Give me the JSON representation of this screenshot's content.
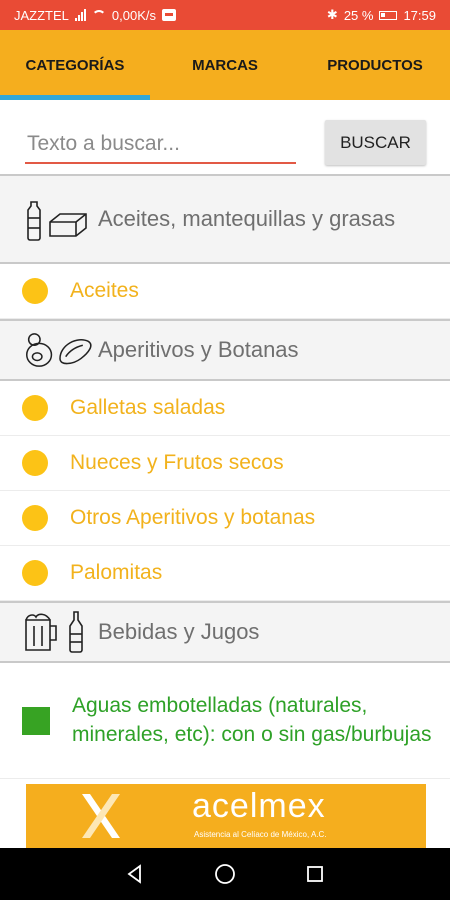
{
  "status_bar": {
    "carrier": "JAZZTEL",
    "speed": "0,00K/s",
    "battery": "25 %",
    "time": "17:59"
  },
  "tabs": [
    {
      "label": "CATEGORÍAS",
      "active": true
    },
    {
      "label": "MARCAS",
      "active": false
    },
    {
      "label": "PRODUCTOS",
      "active": false
    }
  ],
  "search": {
    "placeholder": "Texto a buscar...",
    "button_label": "BUSCAR"
  },
  "list": [
    {
      "kind": "category",
      "label": "Aceites, mantequillas y grasas",
      "icon": "oil-butter-icon"
    },
    {
      "kind": "item",
      "label": "Aceites",
      "color": "#fcc316"
    },
    {
      "kind": "category",
      "label": "Aperitivos y Botanas",
      "icon": "snacks-icon"
    },
    {
      "kind": "item",
      "label": "Galletas saladas",
      "color": "#fcc316"
    },
    {
      "kind": "item",
      "label": "Nueces y Frutos secos",
      "color": "#fcc316"
    },
    {
      "kind": "item",
      "label": "Otros Aperitivos y botanas",
      "color": "#fcc316"
    },
    {
      "kind": "item",
      "label": "Palomitas",
      "color": "#fcc316"
    },
    {
      "kind": "category",
      "label": "Bebidas y Jugos",
      "icon": "beverages-icon"
    },
    {
      "kind": "item",
      "label": "Aguas embotelladas (naturales, minerales, etc): con o sin gas/burbujas",
      "color": "#37a323"
    }
  ],
  "banner": {
    "brand": "acelmex",
    "subtitle": "Asistencia al Celíaco de México, A.C."
  },
  "colors": {
    "status_bar": "#e94b35",
    "tab_bar": "#f5ae1e",
    "tab_indicator": "#31a7d7",
    "yellow_dot": "#fcc316",
    "green_square": "#37a323"
  }
}
